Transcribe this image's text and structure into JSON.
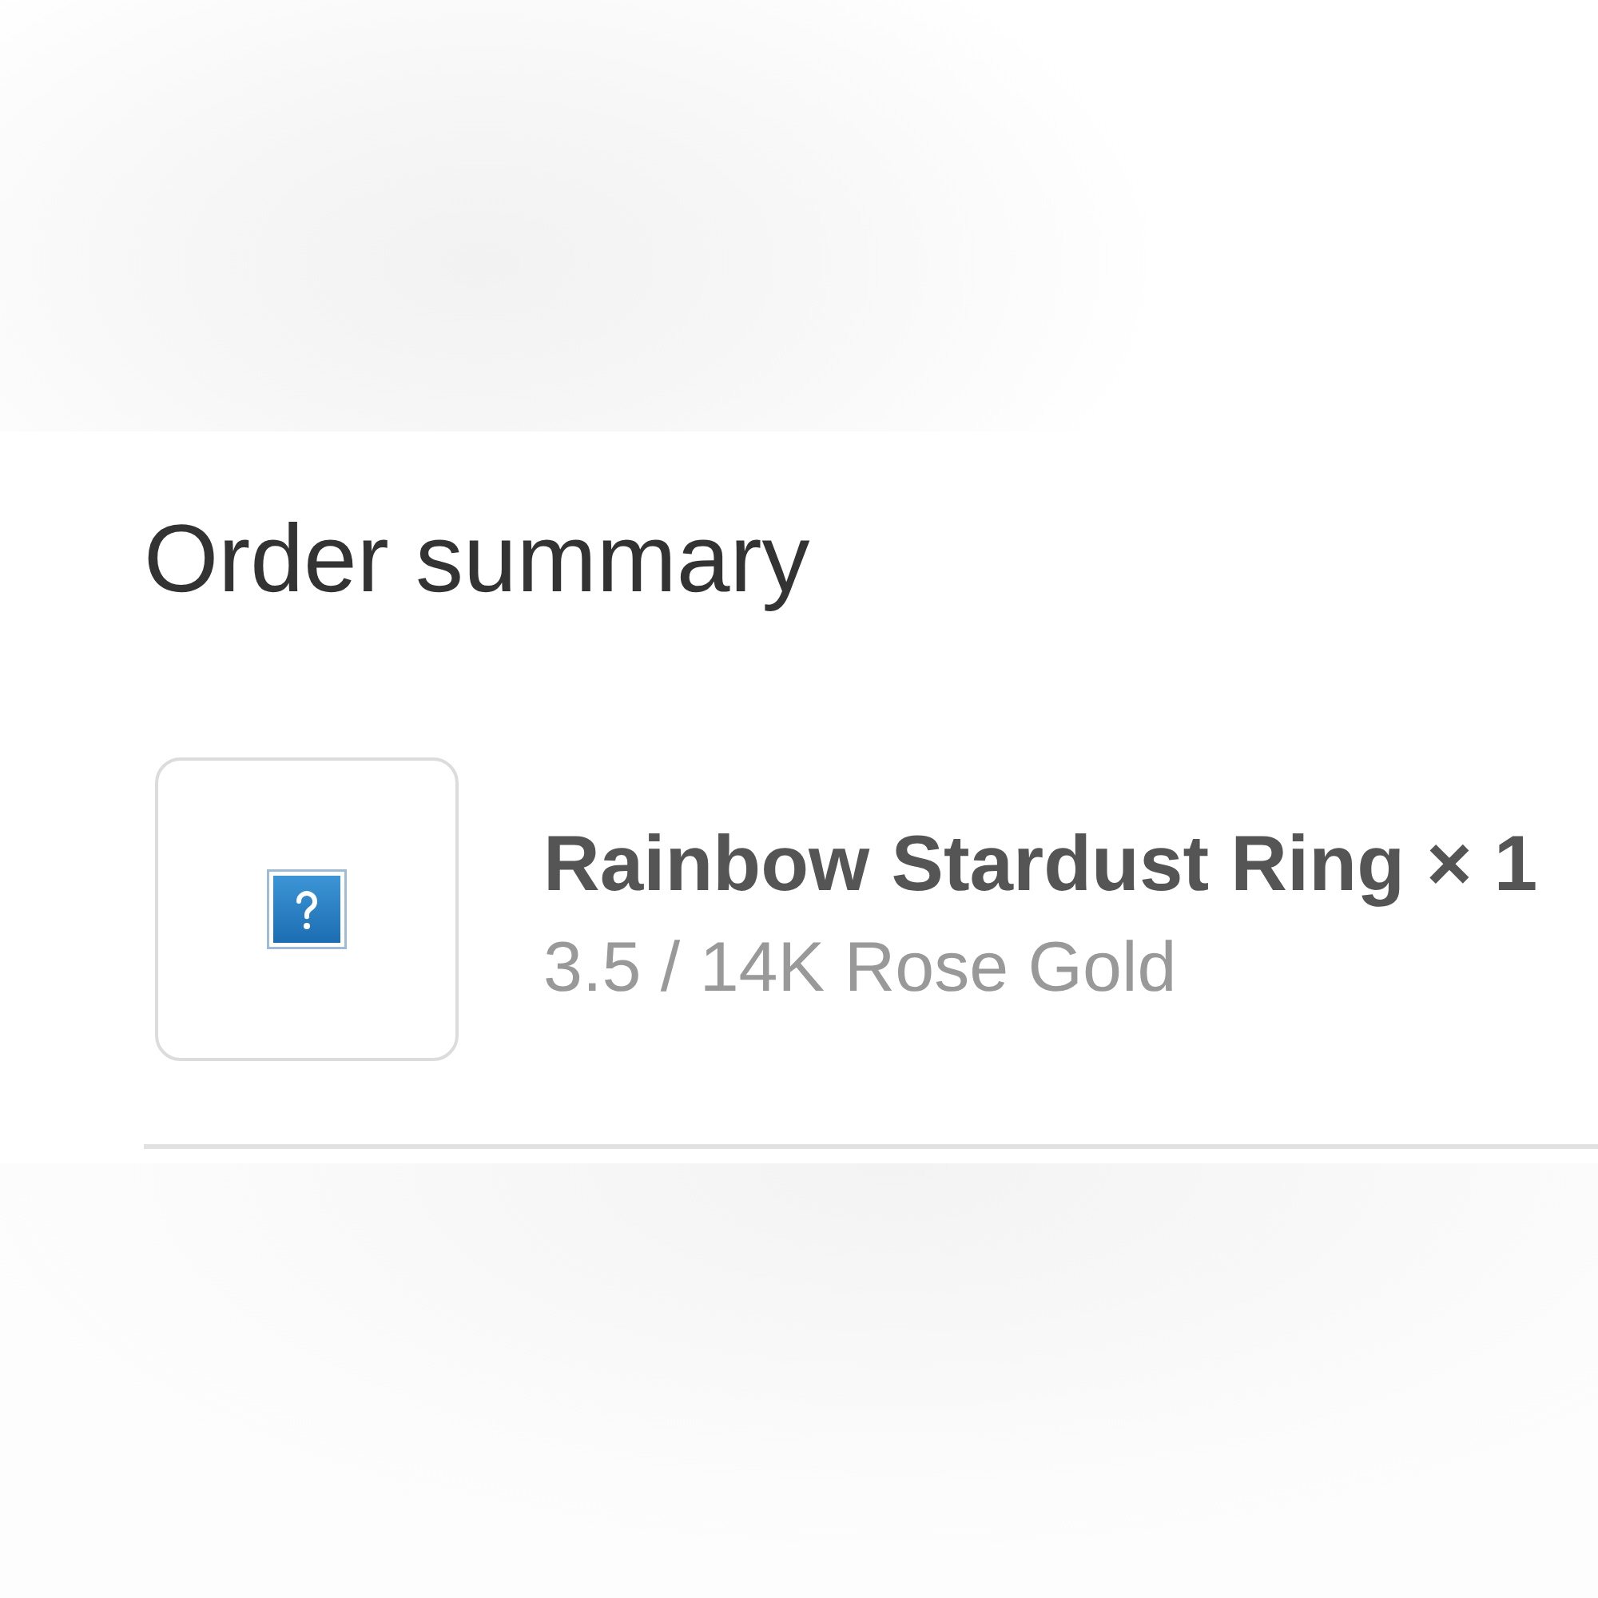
{
  "order_summary": {
    "title": "Order summary",
    "items": [
      {
        "name": "Rainbow Stardust Ring × 1",
        "variant": "3.5 / 14K Rose Gold"
      }
    ]
  }
}
